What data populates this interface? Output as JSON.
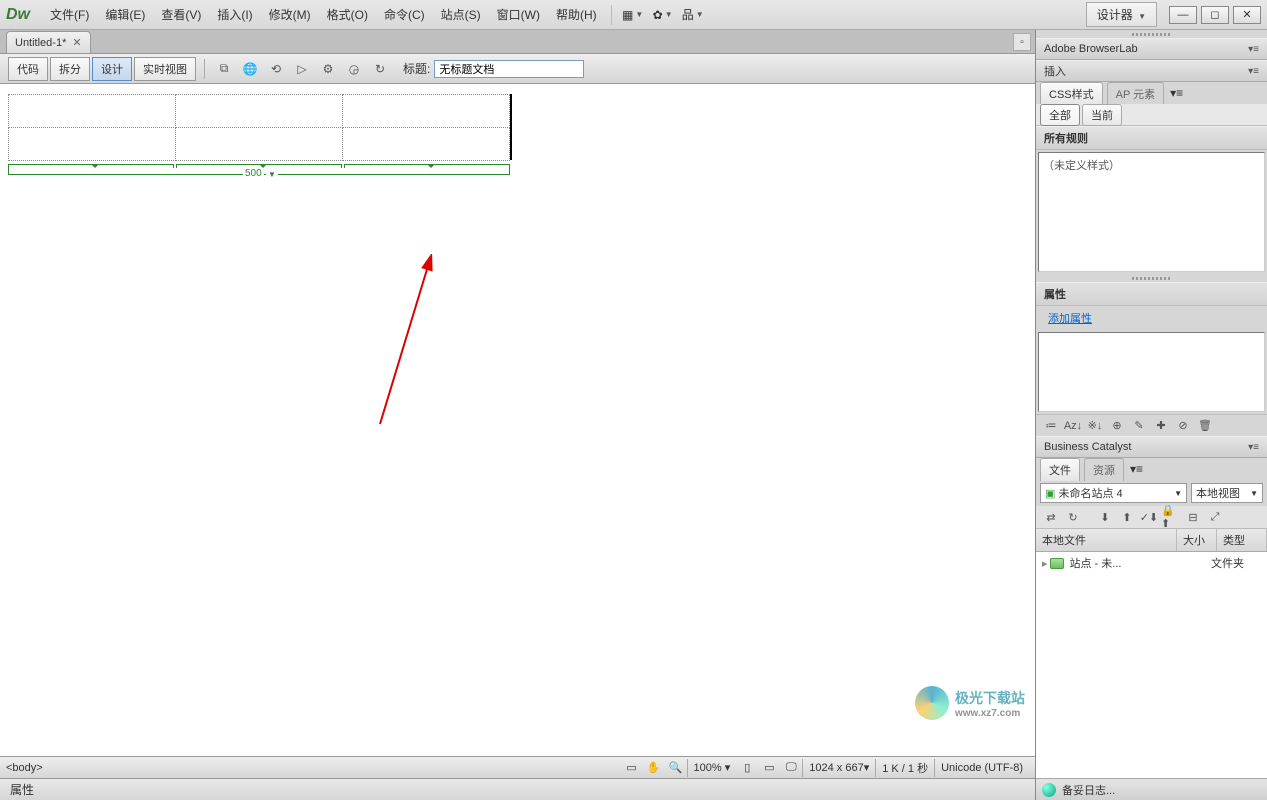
{
  "menubar": {
    "items": [
      "文件(F)",
      "编辑(E)",
      "查看(V)",
      "插入(I)",
      "修改(M)",
      "格式(O)",
      "命令(C)",
      "站点(S)",
      "窗口(W)",
      "帮助(H)"
    ],
    "workspace": "设计器"
  },
  "tabs": {
    "doc": "Untitled-1*"
  },
  "docToolbar": {
    "views": [
      "代码",
      "拆分",
      "设计",
      "实时视图"
    ],
    "activeView": 2,
    "titleLabel": "标题:",
    "titleValue": "无标题文档"
  },
  "canvas": {
    "tableWidth": "500",
    "rulerSegments": [
      166,
      166,
      168
    ]
  },
  "status": {
    "tag": "<body>",
    "zoom": "100%",
    "dims": "1024 x 667",
    "size": "1 K / 1 秒",
    "encoding": "Unicode (UTF-8)"
  },
  "propBar": {
    "label": "属性"
  },
  "side": {
    "browserlab": "Adobe BrowserLab",
    "insert": "插入",
    "cssTab": "CSS样式",
    "apTab": "AP 元素",
    "pillAll": "全部",
    "pillCurrent": "当前",
    "allRules": "所有规则",
    "noStyle": "（未定义样式）",
    "propsHdr": "属性",
    "addProp": "添加属性",
    "bizcat": "Business Catalyst",
    "filesTab": "文件",
    "resTab": "资源",
    "site": "未命名站点 4",
    "viewMode": "本地视图",
    "colLocal": "本地文件",
    "colSize": "大小",
    "colType": "类型",
    "rowName": "站点 - 未...",
    "rowType": "文件夹",
    "ready": "备妥",
    "log": "日志..."
  },
  "watermark": {
    "text": "极光下载站",
    "url": "www.xz7.com"
  }
}
